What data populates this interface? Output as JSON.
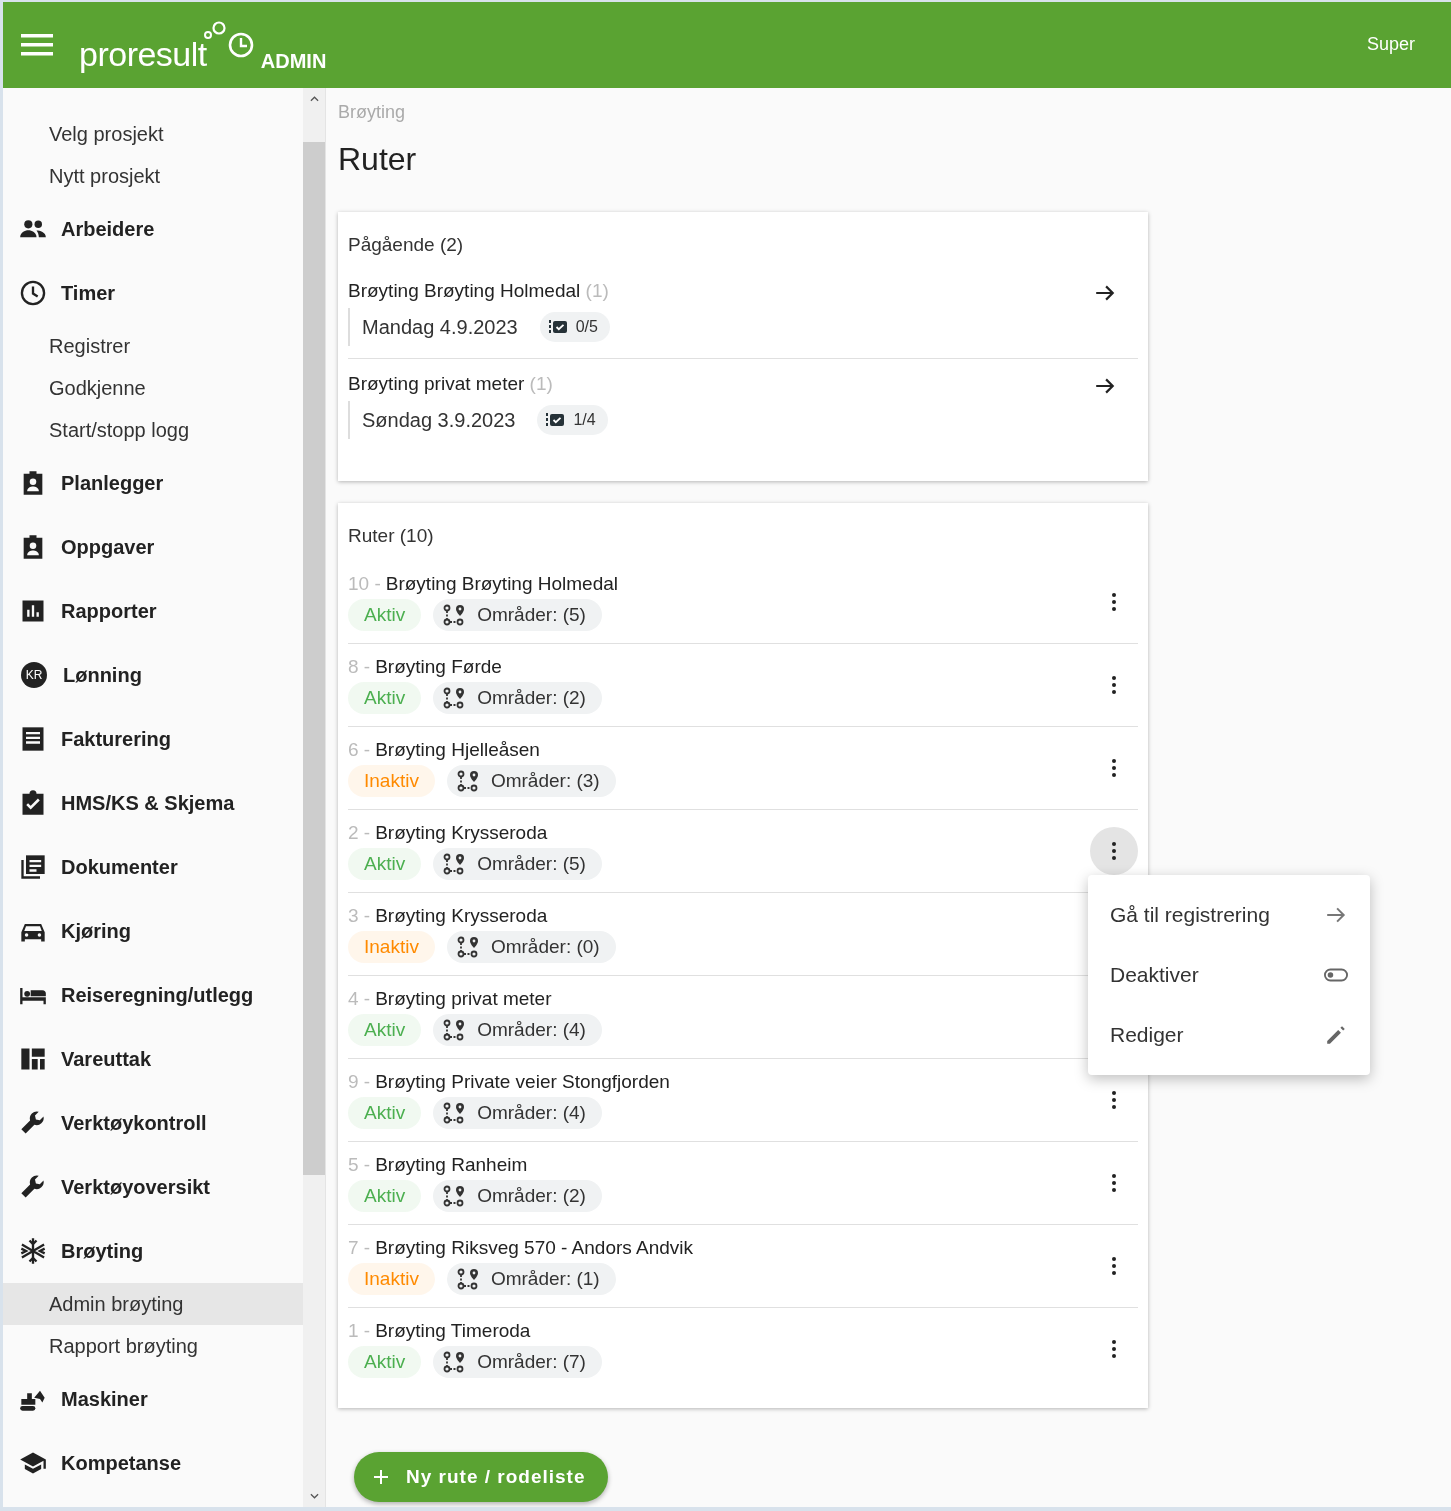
{
  "header": {
    "brand": "proresult",
    "badge": "ADMIN",
    "user": "Super"
  },
  "sidebar": {
    "items": [
      {
        "kind": "link",
        "label": "Velg prosjekt",
        "selected": false
      },
      {
        "kind": "link",
        "label": "Nytt prosjekt",
        "selected": false
      },
      {
        "kind": "group",
        "label": "Arbeidere"
      },
      {
        "kind": "group",
        "label": "Timer"
      },
      {
        "kind": "link",
        "label": "Registrer",
        "selected": false
      },
      {
        "kind": "link",
        "label": "Godkjenne",
        "selected": false
      },
      {
        "kind": "link",
        "label": "Start/stopp logg",
        "selected": false
      },
      {
        "kind": "group",
        "label": "Planlegger"
      },
      {
        "kind": "group",
        "label": "Oppgaver"
      },
      {
        "kind": "group",
        "label": "Rapporter"
      },
      {
        "kind": "group",
        "label": "Lønning",
        "icon_text": "KR"
      },
      {
        "kind": "group",
        "label": "Fakturering"
      },
      {
        "kind": "group",
        "label": "HMS/KS & Skjema"
      },
      {
        "kind": "group",
        "label": "Dokumenter"
      },
      {
        "kind": "group",
        "label": "Kjøring"
      },
      {
        "kind": "group",
        "label": "Reiseregning/utlegg"
      },
      {
        "kind": "group",
        "label": "Vareuttak"
      },
      {
        "kind": "group",
        "label": "Verktøykontroll"
      },
      {
        "kind": "group",
        "label": "Verktøyoversikt"
      },
      {
        "kind": "group",
        "label": "Brøyting"
      },
      {
        "kind": "link",
        "label": "Admin brøyting",
        "selected": true
      },
      {
        "kind": "link",
        "label": "Rapport brøyting",
        "selected": false
      },
      {
        "kind": "group",
        "label": "Maskiner"
      },
      {
        "kind": "group",
        "label": "Kompetanse"
      }
    ]
  },
  "breadcrumb": "Brøyting",
  "title": "Ruter",
  "ongoing": {
    "title": "Pågående (2)",
    "items": [
      {
        "name": "Brøyting Brøyting Holmedal",
        "count": "(1)",
        "date": "Mandag 4.9.2023",
        "progress": "0/5"
      },
      {
        "name": "Brøyting privat meter",
        "count": "(1)",
        "date": "Søndag 3.9.2023",
        "progress": "1/4"
      }
    ]
  },
  "routes": {
    "title": "Ruter (10)",
    "items": [
      {
        "number": "10 -",
        "name": "Brøyting Brøyting Holmedal",
        "status_label": "Aktiv",
        "color": "#4caf50",
        "areas": "Områder: (5)",
        "menu_open": false
      },
      {
        "number": "8 -",
        "name": "Brøyting Førde",
        "status_label": "Aktiv",
        "color": "#4caf50",
        "areas": "Områder: (2)",
        "menu_open": false
      },
      {
        "number": "6 -",
        "name": "Brøyting Hjelleåsen",
        "status_label": "Inaktiv",
        "color": "#ff8a00",
        "areas": "Områder: (3)",
        "menu_open": false
      },
      {
        "number": "2 -",
        "name": "Brøyting Krysseroda",
        "status_label": "Aktiv",
        "color": "#4caf50",
        "areas": "Områder: (5)",
        "menu_open": true
      },
      {
        "number": "3 -",
        "name": "Brøyting Krysseroda",
        "status_label": "Inaktiv",
        "color": "#ff8a00",
        "areas": "Områder: (0)",
        "menu_open": false
      },
      {
        "number": "4 -",
        "name": "Brøyting privat meter",
        "status_label": "Aktiv",
        "color": "#4caf50",
        "areas": "Områder: (4)",
        "menu_open": false
      },
      {
        "number": "9 -",
        "name": "Brøyting Private veier Stongfjorden",
        "status_label": "Aktiv",
        "color": "#4caf50",
        "areas": "Områder: (4)",
        "menu_open": false
      },
      {
        "number": "5 -",
        "name": "Brøyting Ranheim",
        "status_label": "Aktiv",
        "color": "#4caf50",
        "areas": "Områder: (2)",
        "menu_open": false
      },
      {
        "number": "7 -",
        "name": "Brøyting Riksveg 570 - Andors Andvik",
        "status_label": "Inaktiv",
        "color": "#ff8a00",
        "areas": "Områder: (1)",
        "menu_open": false
      },
      {
        "number": "1 -",
        "name": "Brøyting Timeroda",
        "status_label": "Aktiv",
        "color": "#4caf50",
        "areas": "Områder: (7)",
        "menu_open": false
      }
    ]
  },
  "context_menu": {
    "items": [
      {
        "kind": "navigate",
        "label": "Gå til registrering"
      },
      {
        "kind": "toggle",
        "label": "Deaktiver"
      },
      {
        "kind": "edit",
        "label": "Rediger"
      }
    ]
  },
  "new_button": {
    "label": "Ny rute / rodeliste"
  }
}
